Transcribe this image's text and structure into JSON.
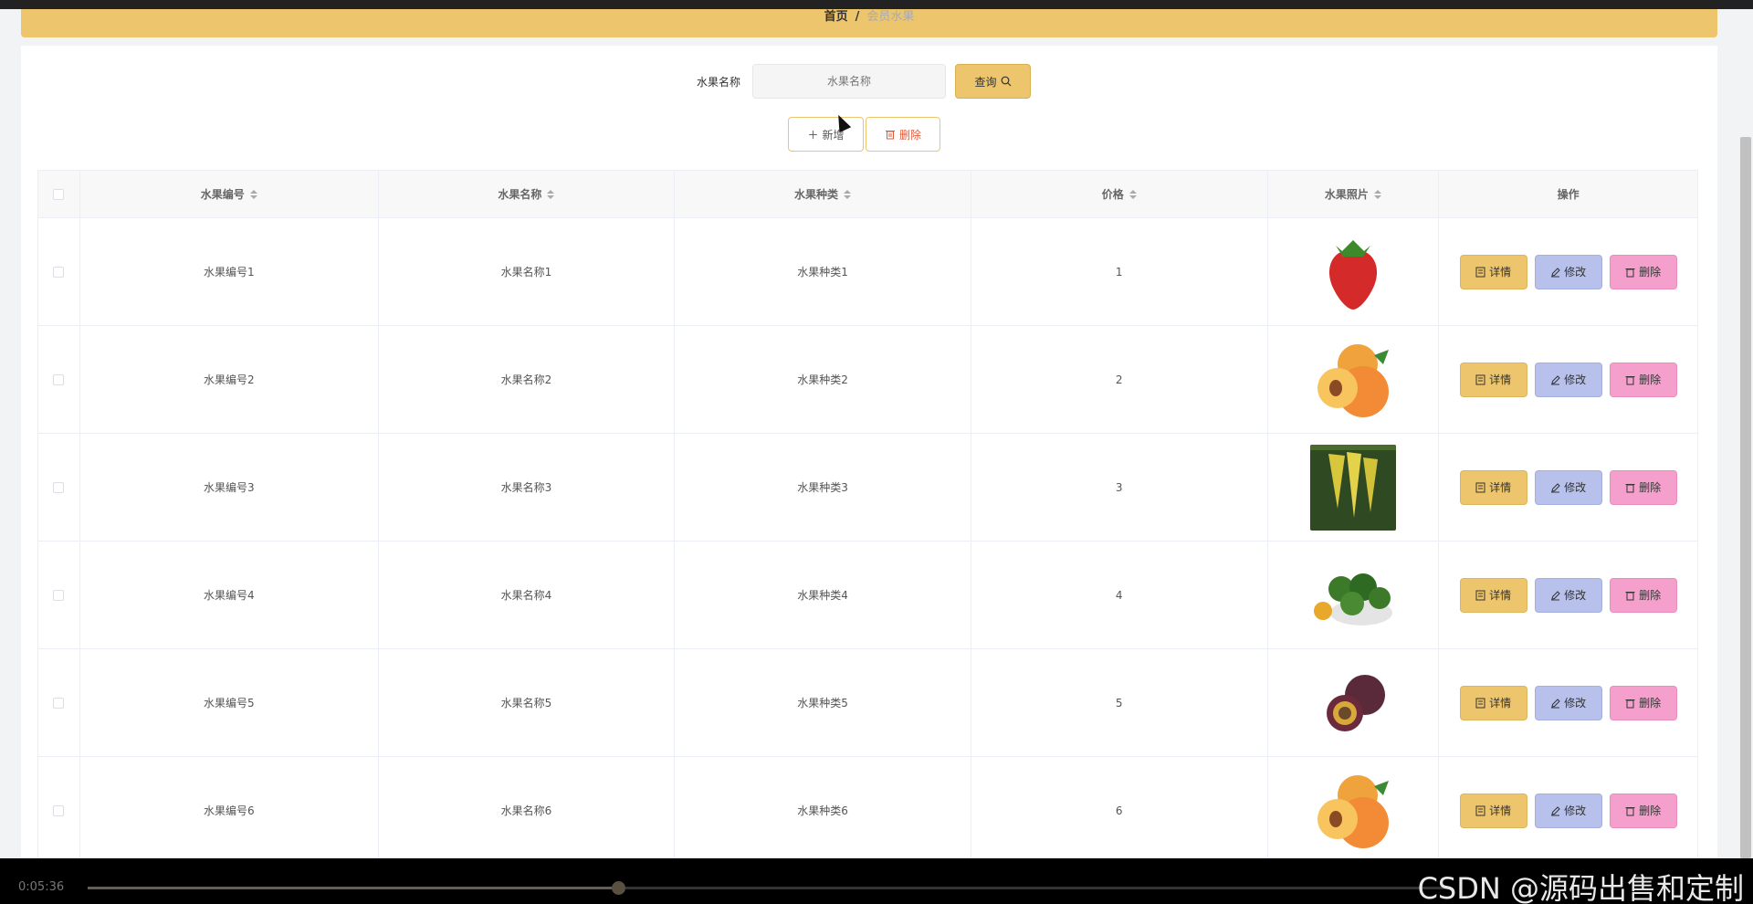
{
  "breadcrumb": {
    "home": "首页",
    "separator": "/",
    "current": "会员水果"
  },
  "search": {
    "label": "水果名称",
    "placeholder": "水果名称",
    "value": "",
    "button_label": "查询"
  },
  "actions": {
    "add_label": "新增",
    "delete_label": "删除"
  },
  "table": {
    "headers": [
      "水果编号",
      "水果名称",
      "水果种类",
      "价格",
      "水果照片",
      "操作"
    ],
    "rows": [
      {
        "code": "水果编号1",
        "name": "水果名称1",
        "type": "水果种类1",
        "price": "1",
        "photo": "strawberry"
      },
      {
        "code": "水果编号2",
        "name": "水果名称2",
        "type": "水果种类2",
        "price": "2",
        "photo": "apricot"
      },
      {
        "code": "水果编号3",
        "name": "水果名称3",
        "type": "水果种类3",
        "price": "3",
        "photo": "starfruit"
      },
      {
        "code": "水果编号4",
        "name": "水果名称4",
        "type": "水果种类4",
        "price": "4",
        "photo": "green-citrus"
      },
      {
        "code": "水果编号5",
        "name": "水果名称5",
        "type": "水果种类5",
        "price": "5",
        "photo": "passion-fruit"
      },
      {
        "code": "水果编号6",
        "name": "水果名称6",
        "type": "水果种类6",
        "price": "6",
        "photo": "apricot"
      }
    ],
    "row_actions": {
      "detail": "详情",
      "edit": "修改",
      "delete": "删除"
    }
  },
  "video": {
    "time": "0:05:36",
    "progress": 0.39
  },
  "watermark": "CSDN @源码出售和定制",
  "colors": {
    "accent": "#ecc56c",
    "edit": "#b7c1ec",
    "delete": "#f59fcd"
  }
}
